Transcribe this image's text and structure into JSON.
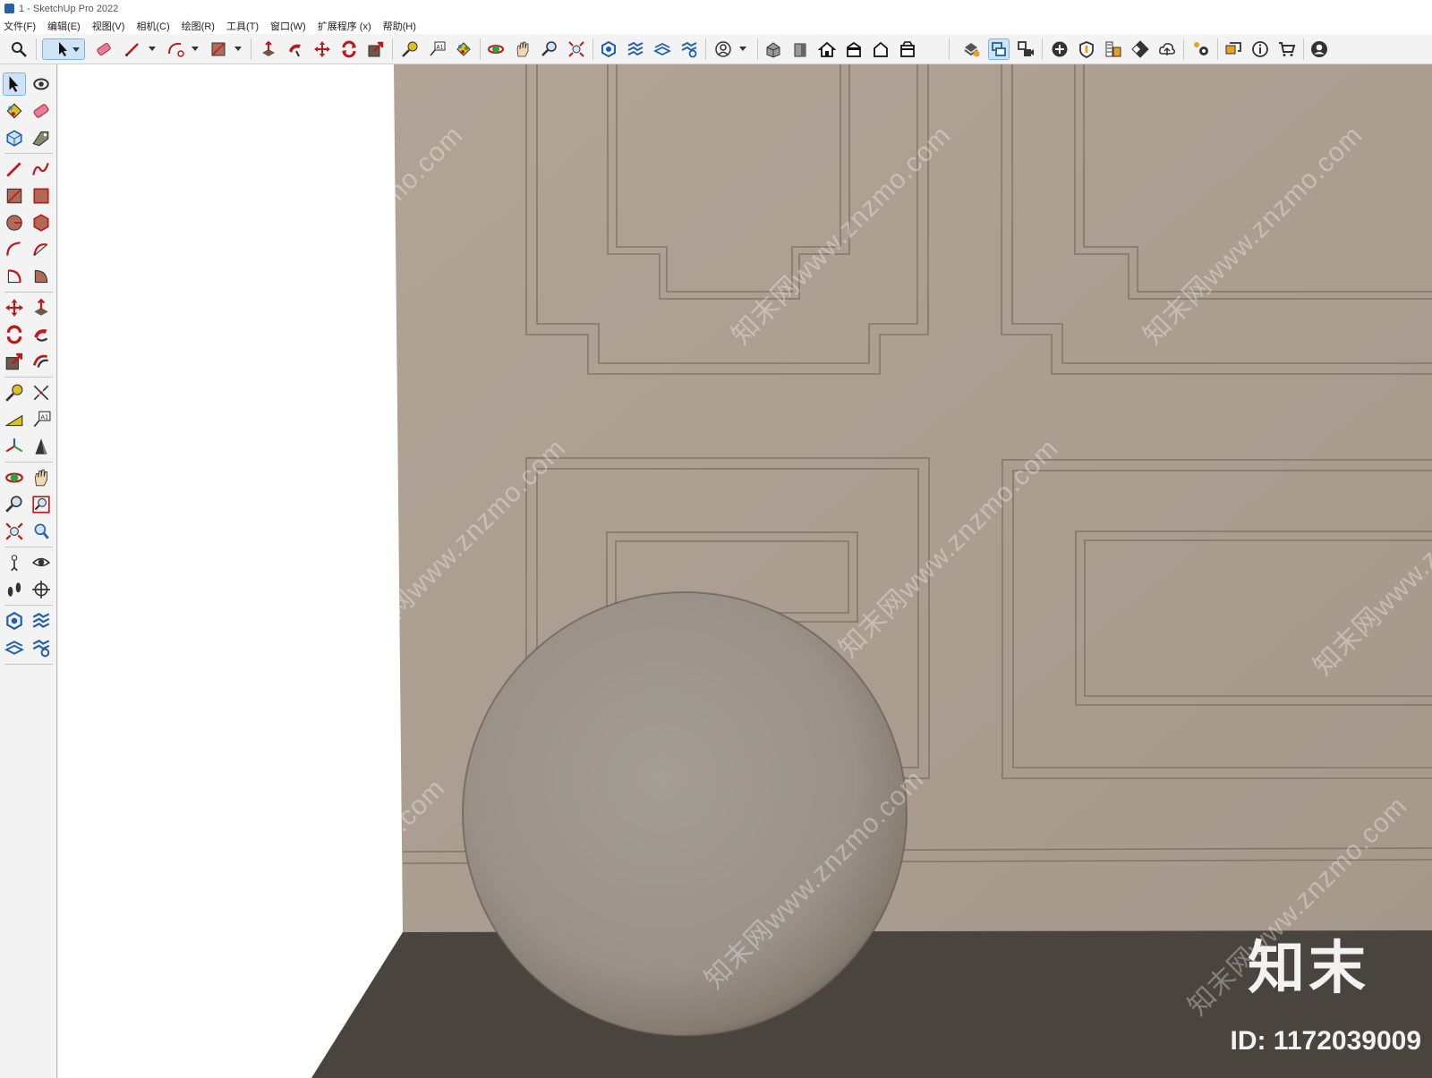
{
  "window": {
    "title": "1 - SketchUp Pro 2022"
  },
  "menu": [
    "文件(F)",
    "编辑(E)",
    "视图(V)",
    "相机(C)",
    "绘图(R)",
    "工具(T)",
    "窗口(W)",
    "扩展程序 (x)",
    "帮助(H)"
  ],
  "colors": {
    "wall": "#ad9f91",
    "floor": "#4a443f",
    "sphere": "#a39b92",
    "molding_line": "#7d7165",
    "toolbar_bg": "#f3f3f3",
    "active_tool": "#cfe3f7"
  },
  "toolbar_icons": [
    "search-icon",
    "select-icon",
    "eraser-icon",
    "line-icon",
    "arc-icon",
    "rectangle-icon",
    "push-pull-icon",
    "follow-me-icon",
    "move-icon",
    "rotate-icon",
    "scale-icon",
    "tape-measure-icon",
    "text-icon",
    "paint-bucket-icon",
    "orbit-icon",
    "pan-icon",
    "zoom-icon",
    "zoom-extents-icon",
    "section-plane-icon",
    "section-cut-icon",
    "section-fill-icon",
    "display-section-icon",
    "profile-icon",
    "iso-view-icon",
    "front-view-icon",
    "top-view-icon",
    "right-view-icon",
    "back-view-icon",
    "left-view-icon",
    "style-builder-icon",
    "tag-icon",
    "scene-icon",
    "add-location-icon",
    "shield-icon",
    "material-icon",
    "checker-icon",
    "upload-icon",
    "settings-icon",
    "comments-icon",
    "info-icon",
    "cart-icon",
    "account-icon"
  ],
  "left_toolbar_icons": [
    "select-icon",
    "orbit-icon",
    "paint-bucket-icon",
    "eraser-icon",
    "component-icon",
    "tag-icon",
    "line-icon",
    "freehand-icon",
    "rectangle-icon",
    "rotated-rectangle-icon",
    "circle-icon",
    "polygon-icon",
    "arc-icon",
    "three-point-arc-icon",
    "pie-icon",
    "two-point-arc-icon",
    "move-icon",
    "push-pull-icon",
    "rotate-icon",
    "follow-me-icon",
    "scale-icon",
    "offset-icon",
    "tape-measure-icon",
    "dimension-icon",
    "protractor-icon",
    "text-icon",
    "axes-icon",
    "3d-text-icon",
    "orbit-view-icon",
    "pan-icon",
    "zoom-icon",
    "zoom-window-icon",
    "zoom-extents-icon",
    "previous-view-icon",
    "position-camera-icon",
    "look-around-icon",
    "walk-icon",
    "section-icon",
    "section-plane-icon",
    "section-cut-icon",
    "section-fill-icon",
    "display-section-icon"
  ],
  "watermark": {
    "text": "知末网www.znzmo.com",
    "brand": "知末",
    "image_id": "ID: 1172039009"
  }
}
